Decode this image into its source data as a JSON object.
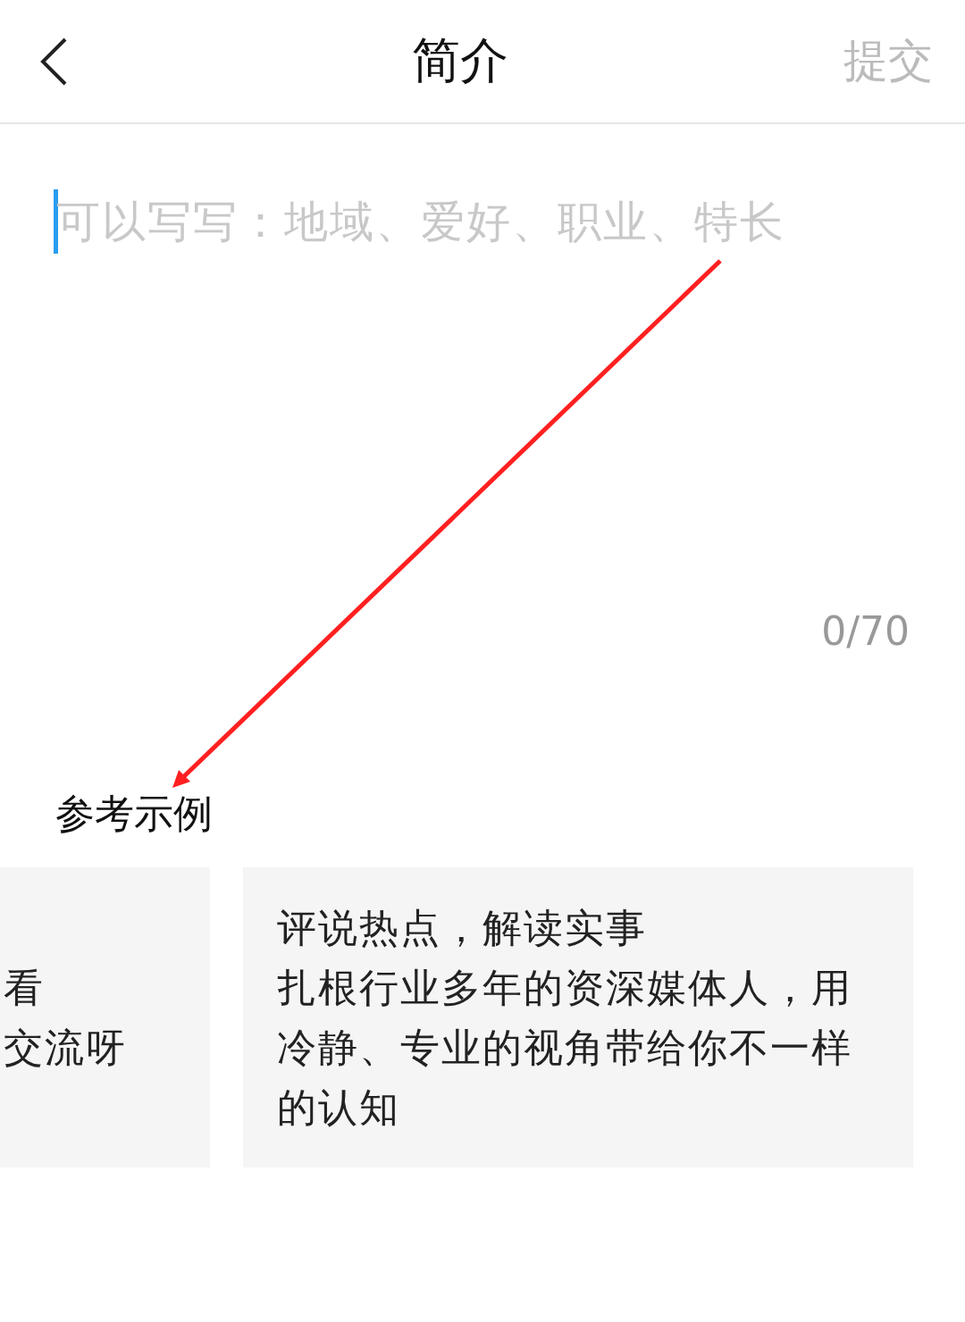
{
  "header": {
    "title": "简介",
    "submit": {
      "label": "提交",
      "disabled": true
    }
  },
  "editor": {
    "placeholder": "可以写写：地域、爱好、职业、特长",
    "focused": true,
    "counter": "0/70"
  },
  "examples": {
    "heading": "参考示例",
    "cards": [
      {
        "lines": [
          "看",
          "交流呀"
        ]
      },
      {
        "lines": [
          "评说热点，解读实事",
          "扎根行业多年的资深媒体人，用冷静、专业的视角带给你不一样的认知"
        ]
      }
    ]
  }
}
